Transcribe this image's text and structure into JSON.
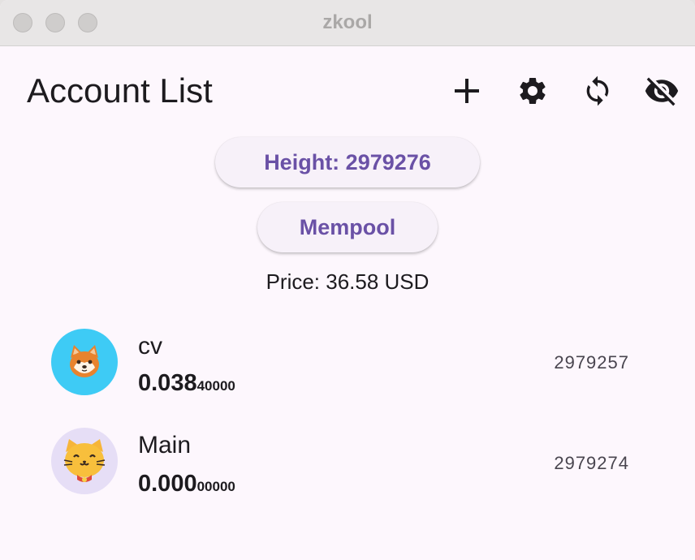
{
  "window": {
    "title": "zkool"
  },
  "header": {
    "title": "Account List",
    "actions": [
      {
        "icon": "plus-icon"
      },
      {
        "icon": "gear-icon"
      },
      {
        "icon": "sync-icon"
      },
      {
        "icon": "eye-off-icon"
      }
    ]
  },
  "status": {
    "height_label": "Height: 2979276",
    "mempool_label": "Mempool",
    "price_label": "Price: 36.58 USD"
  },
  "accounts": [
    {
      "name": "cv",
      "balance_main": "0.038",
      "balance_small": "40000",
      "height": "2979257",
      "avatar": "shiba-dog-icon",
      "avatar_bg": "#3ecbf5"
    },
    {
      "name": "Main",
      "balance_main": "0.000",
      "balance_small": "00000",
      "height": "2979274",
      "avatar": "cat-face-icon",
      "avatar_bg": "#e6def6"
    }
  ],
  "colors": {
    "accent": "#6a51a6",
    "background": "#fdf7fd",
    "text": "#1d1b1f"
  }
}
